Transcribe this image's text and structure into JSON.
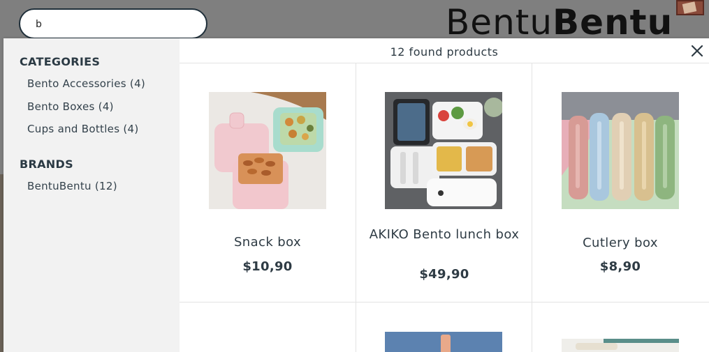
{
  "search": {
    "value": "b",
    "placeholder": ""
  },
  "logo": {
    "part1": "Bentu",
    "part2": "Bentu"
  },
  "results": {
    "count_text": "12 found products"
  },
  "facets": {
    "categories_title": "CATEGORIES",
    "categories": [
      {
        "label": "Bento Accessories (4)"
      },
      {
        "label": "Bento Boxes (4)"
      },
      {
        "label": "Cups and Bottles (4)"
      }
    ],
    "brands_title": "BRANDS",
    "brands": [
      {
        "label": "BentuBentu (12)"
      }
    ]
  },
  "products": [
    {
      "name": "Snack box",
      "price": "$10,90"
    },
    {
      "name": "AKIKO Bento lunch box",
      "price": "$49,90"
    },
    {
      "name": "Cutlery box",
      "price": "$8,90"
    }
  ],
  "icons": {
    "close": "close-icon"
  },
  "colors": {
    "text": "#2e3b44",
    "sidebar_bg": "#f2f2f2",
    "overlay_bg": "#7f7f7f",
    "search_border": "#1f2f3a"
  }
}
